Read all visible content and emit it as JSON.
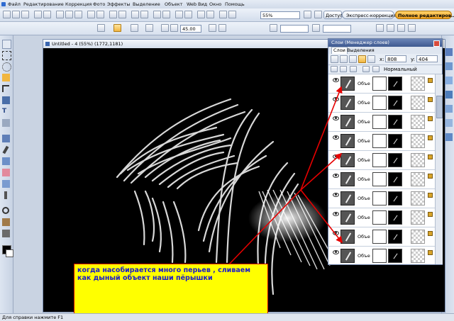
{
  "menu": [
    "Файл",
    "Редактирование",
    "Коррекция",
    "Фото",
    "Эффекты",
    "Выделение",
    "Объект",
    "Web",
    "Вид",
    "Окно",
    "Помощь"
  ],
  "toolbar1": {
    "zoom_value": "55%",
    "access_label": "Доступ",
    "express_label": "Экспресс-коррекция",
    "full_edit_label": "Полное редактиров..."
  },
  "toolbar2": {
    "angle_value": "45.00"
  },
  "document": {
    "title": "Untitled - 4 (55%) (1772,1181)"
  },
  "layers_panel": {
    "title": "Слои (Менеджер слоев)",
    "tabs": [
      "Слои",
      "Выделения"
    ],
    "x_label": "x:",
    "x_value": "808",
    "y_label": "y:",
    "y_value": "404",
    "blend_mode": "Нормальный",
    "layer_name": "Объе",
    "layers": [
      {
        "name": "Объе",
        "visible": true
      },
      {
        "name": "Объе",
        "visible": true
      },
      {
        "name": "Объе",
        "visible": true
      },
      {
        "name": "Объе",
        "visible": true
      },
      {
        "name": "Объе",
        "visible": true
      },
      {
        "name": "Объе",
        "visible": true
      },
      {
        "name": "Объе",
        "visible": true
      },
      {
        "name": "Объе",
        "visible": true
      },
      {
        "name": "Объе",
        "visible": true
      },
      {
        "name": "Объе",
        "visible": true
      }
    ]
  },
  "note": {
    "text": "когда насобирается много перьев , сливаем как дыный объект наши пёрышки"
  },
  "status": {
    "text": "Для справки нажмите F1"
  },
  "colors": {
    "accent": "#f0a21f",
    "note_bg": "#ffff00",
    "note_text": "#1a1acc",
    "arrow": "#e60000"
  },
  "icons": [
    "move-icon",
    "select-icon",
    "lasso-icon",
    "crop-icon",
    "brush-icon",
    "eraser-icon",
    "text-icon",
    "zoom-icon",
    "eye-icon",
    "lock-icon"
  ]
}
